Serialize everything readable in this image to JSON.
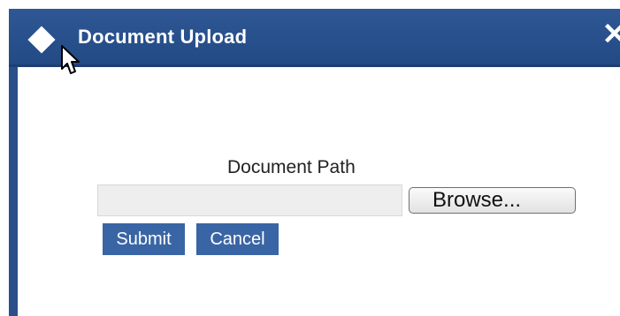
{
  "dialog": {
    "title": "Document Upload",
    "close_glyph": "✕",
    "title_icon": "diamond-icon"
  },
  "form": {
    "label": "Document Path",
    "path_value": "",
    "browse_label": "Browse...",
    "submit_label": "Submit",
    "cancel_label": "Cancel"
  },
  "colors": {
    "titlebar": "#2b5089",
    "button": "#3a65a5",
    "input_bg": "#eeeeee"
  }
}
